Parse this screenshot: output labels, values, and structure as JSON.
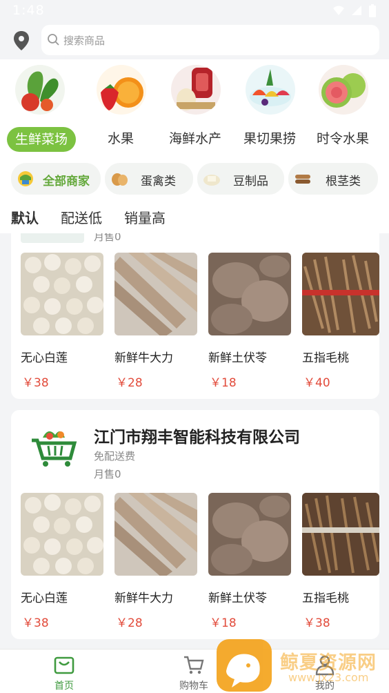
{
  "status": {
    "time": "1:48"
  },
  "search": {
    "placeholder": "搜索商品"
  },
  "categories": [
    {
      "label": "生鲜菜场",
      "active": true
    },
    {
      "label": "水果"
    },
    {
      "label": "海鲜水产"
    },
    {
      "label": "果切果捞"
    },
    {
      "label": "时令水果"
    }
  ],
  "chips": [
    {
      "label": "全部商家",
      "active": true
    },
    {
      "label": "蛋禽类"
    },
    {
      "label": "豆制品"
    },
    {
      "label": "根茎类"
    }
  ],
  "sorts": [
    {
      "label": "默认",
      "active": true
    },
    {
      "label": "配送低"
    },
    {
      "label": "销量高"
    }
  ],
  "merchants": [
    {
      "sales": "月售0",
      "products": [
        {
          "name": "无心白莲",
          "price": "￥38"
        },
        {
          "name": "新鲜牛大力",
          "price": "￥28"
        },
        {
          "name": "新鲜土伏苓",
          "price": "￥18"
        },
        {
          "name": "五指毛桃",
          "price": "￥40"
        }
      ]
    },
    {
      "name": "江门市翔丰智能科技有限公司",
      "delivery": "免配送费",
      "sales": "月售0",
      "products": [
        {
          "name": "无心白莲",
          "price": "￥38"
        },
        {
          "name": "新鲜牛大力",
          "price": "￥28"
        },
        {
          "name": "新鲜土伏苓",
          "price": "￥18"
        },
        {
          "name": "五指毛桃",
          "price": "￥38"
        }
      ]
    }
  ],
  "tabbar": [
    {
      "label": "首页",
      "active": true
    },
    {
      "label": "购物车"
    },
    {
      "label": "我的"
    }
  ],
  "watermark": {
    "text": "鲸夏资源网",
    "url": "www.jx23.com"
  },
  "colors": {
    "accent": "#7cc241",
    "price": "#e24b3b",
    "active_tab": "#3f9a3f"
  }
}
